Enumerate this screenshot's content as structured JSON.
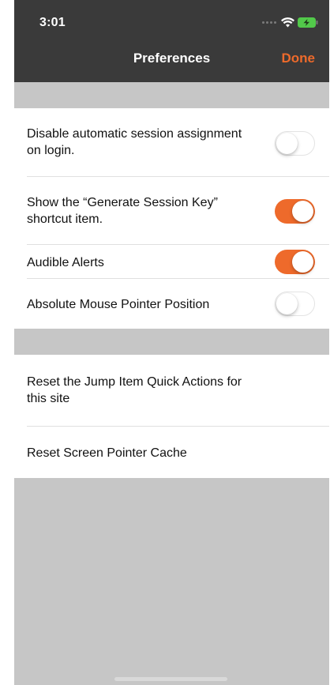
{
  "status_bar": {
    "time": "3:01",
    "icons": [
      "signal-dots-icon",
      "wifi-icon",
      "battery-charging-icon"
    ]
  },
  "nav": {
    "title": "Preferences",
    "done_label": "Done"
  },
  "colors": {
    "accent": "#ee6a2b",
    "nav_background": "#3a3a3a",
    "grouped_background": "#c6c6c6"
  },
  "settings": [
    {
      "label_line1": "Disable automatic session assignment",
      "label_line2": "on login.",
      "enabled": false
    },
    {
      "label_line1": "Show the “Generate Session Key”",
      "label_line2": "shortcut item.",
      "enabled": true
    },
    {
      "label_line1": "Audible Alerts",
      "enabled": true
    },
    {
      "label_line1": "Absolute Mouse Pointer Position",
      "enabled": false
    }
  ],
  "actions": [
    {
      "label_line1": "Reset the Jump Item Quick Actions for",
      "label_line2": "this site"
    },
    {
      "label_line1": "Reset Screen Pointer Cache"
    }
  ]
}
